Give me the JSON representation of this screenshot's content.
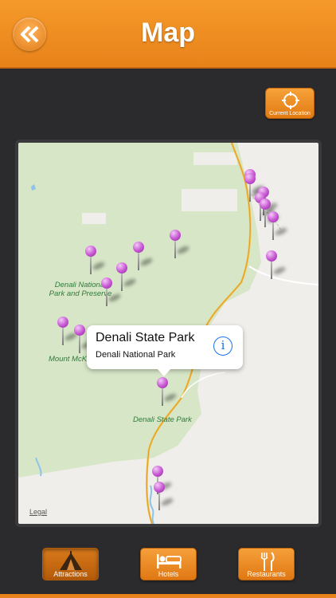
{
  "header": {
    "title": "Map",
    "back_icon": "double-chevron-left-icon",
    "bg_color": "#F08C22"
  },
  "current_location": {
    "label": "Current Location",
    "icon": "crosshair-icon"
  },
  "map": {
    "labels": {
      "park_preserve": "Denali National Park and Preserve",
      "mount": "Mount McKinley",
      "state_park": "Denali State Park",
      "legal": "Legal"
    },
    "callout": {
      "title": "Denali State Park",
      "subtitle": "Denali National Park",
      "info_icon": "info-icon"
    },
    "pin_color": "#C655D2"
  },
  "tabs": [
    {
      "label": "Attractions",
      "icon": "tent-icon",
      "active": true
    },
    {
      "label": "Hotels",
      "icon": "bed-icon",
      "active": false
    },
    {
      "label": "Restaurants",
      "icon": "fork-knife-icon",
      "active": false
    }
  ]
}
